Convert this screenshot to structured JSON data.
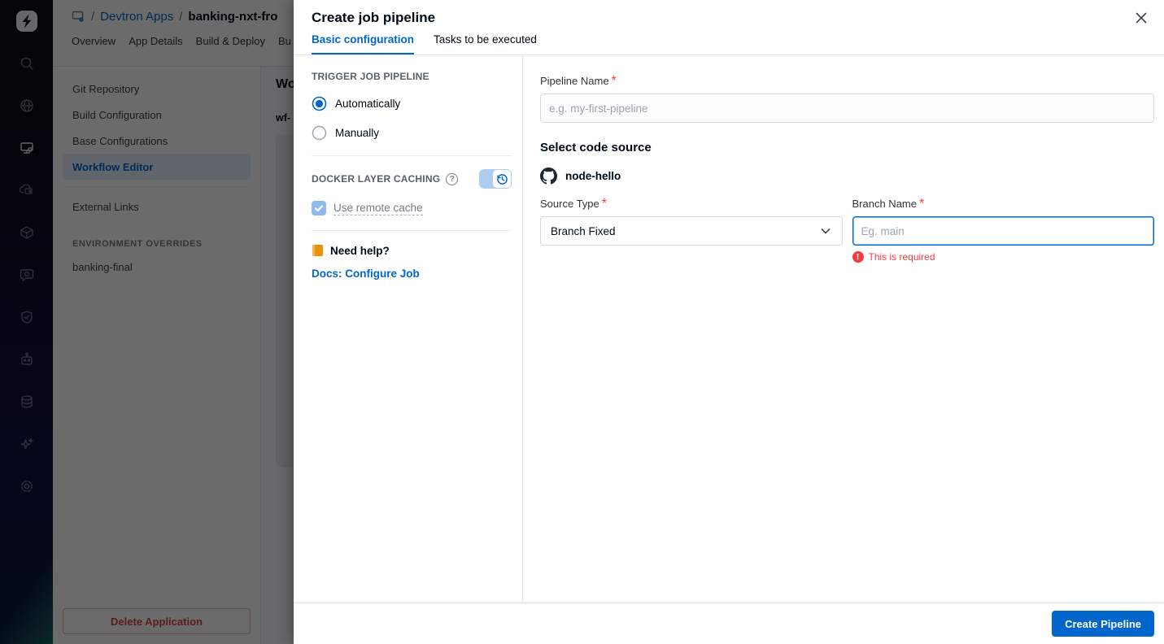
{
  "background": {
    "breadcrumb": {
      "slash1": "/",
      "group": "Devtron Apps",
      "slash2": "/",
      "app": "banking-nxt-fro"
    },
    "tabs": [
      {
        "label": "Overview"
      },
      {
        "label": "App Details"
      },
      {
        "label": "Build & Deploy"
      },
      {
        "label": "Bu"
      }
    ],
    "nav": {
      "items": [
        {
          "label": "Git Repository"
        },
        {
          "label": "Build Configuration"
        },
        {
          "label": "Base Configurations"
        },
        {
          "label": "Workflow Editor"
        },
        {
          "label": "External Links"
        }
      ],
      "active_item": "Workflow Editor",
      "section_header": "ENVIRONMENT OVERRIDES",
      "environment": "banking-final",
      "delete_button": "Delete Application"
    },
    "main": {
      "heading_partial": "Wo",
      "workflow_partial": "wf-"
    },
    "sidebar_icon_names": [
      "devtron-logo",
      "search",
      "resource-browser-globe",
      "applications-monitor",
      "application-groups",
      "chart-store-package",
      "monitoring-chat",
      "security-shield",
      "jobs-robot",
      "clusters-database",
      "ai-sparkles",
      "settings-gear"
    ]
  },
  "modal": {
    "title": "Create job pipeline",
    "tabs": [
      {
        "label": "Basic configuration",
        "active": true
      },
      {
        "label": "Tasks to be executed",
        "active": false
      }
    ],
    "config": {
      "trigger_section_title": "TRIGGER JOB PIPELINE",
      "trigger_options": [
        {
          "label": "Automatically",
          "selected": true
        },
        {
          "label": "Manually",
          "selected": false
        }
      ],
      "dlc_title": "DOCKER LAYER CACHING",
      "dlc_toggle_on": true,
      "remote_cache_label": "Use remote cache",
      "remote_cache_checked": true,
      "help_title": "Need help?",
      "docs_link": "Docs: Configure Job"
    },
    "form": {
      "pipeline_name": {
        "label": "Pipeline Name",
        "required_mark": "*",
        "placeholder": "e.g. my-first-pipeline",
        "value": ""
      },
      "code_source_heading": "Select code source",
      "repository": {
        "name": "node-hello"
      },
      "source_type": {
        "label": "Source Type",
        "required_mark": "*",
        "value": "Branch Fixed"
      },
      "branch_name": {
        "label": "Branch Name",
        "required_mark": "*",
        "placeholder": "Eg. main",
        "value": "",
        "error": "This is required",
        "error_mark": "!"
      }
    },
    "footer": {
      "create_button": "Create Pipeline"
    }
  },
  "colors": {
    "accent": "#0066cc",
    "error": "#f33e3e",
    "nav_active_bg": "#e5f2ff",
    "sidebar_bg": "#0d1130"
  }
}
